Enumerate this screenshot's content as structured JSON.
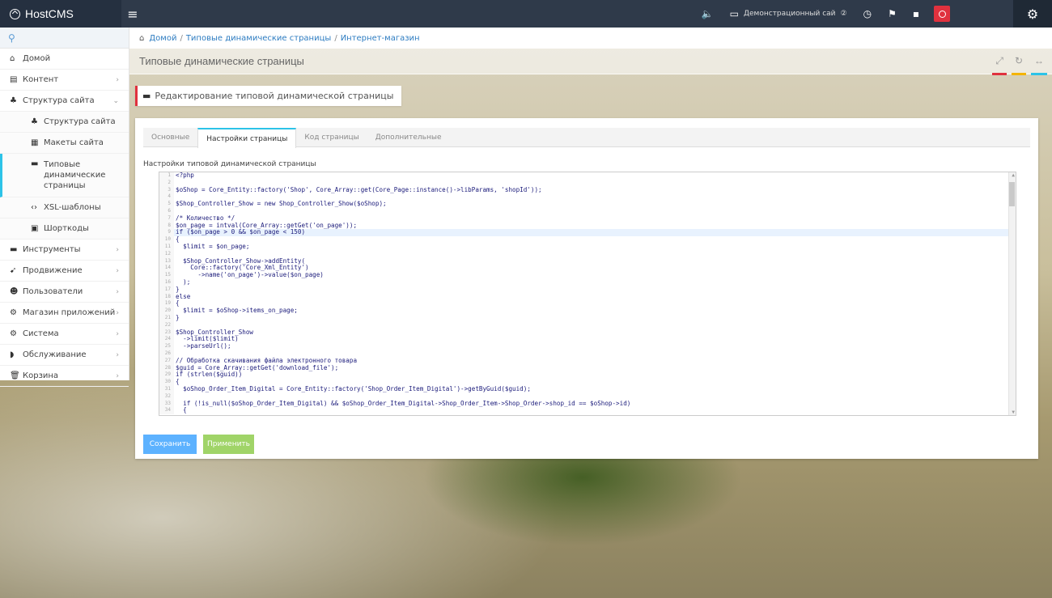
{
  "navbar": {
    "brand": "HostCMS",
    "menu_toggle": "≡",
    "site_label": "Демонстрационный сай",
    "site_badge": "②",
    "colors": {
      "bg": "#2f3a4a",
      "red": "#e0313e"
    }
  },
  "sidebar": {
    "search_icon": "search-icon",
    "items": [
      {
        "label": "Домой",
        "icon": "home-icon"
      },
      {
        "label": "Контент",
        "icon": "newspaper-icon"
      },
      {
        "label": "Структура сайта",
        "icon": "sitemap-icon"
      }
    ],
    "subitems": [
      {
        "label": "Структура сайта",
        "icon": "sitemap-icon"
      },
      {
        "label": "Макеты сайта",
        "icon": "grid-icon"
      },
      {
        "label": "Типовые\nдинамические\nстраницы",
        "icon": "files-icon"
      },
      {
        "label": "XSL-шаблоны",
        "icon": "code-icon"
      },
      {
        "label": "Шорткоды",
        "icon": "shortcode-icon"
      }
    ],
    "bottom_items": [
      {
        "label": "Инструменты",
        "icon": "tools-icon"
      },
      {
        "label": "Продвижение",
        "icon": "rocket-icon"
      },
      {
        "label": "Пользователи",
        "icon": "users-icon"
      },
      {
        "label": "Магазин приложений",
        "icon": "apps-icon"
      },
      {
        "label": "Система",
        "icon": "gear-icon"
      },
      {
        "label": "Обслуживание",
        "icon": "shield-icon"
      },
      {
        "label": "Корзина",
        "icon": "trash-icon"
      }
    ]
  },
  "breadcrumb": {
    "items": [
      "Домой",
      "Типовые динамические страницы",
      "Интернет-магазин"
    ],
    "sep": "/"
  },
  "page": {
    "title": "Типовые динамические страницы",
    "edit_title": "Редактирование типовой динамической страницы"
  },
  "tabs": [
    "Основные",
    "Настройки страницы",
    "Код страницы",
    "Дополнительные"
  ],
  "settings_label": "Настройки типовой динамической страницы",
  "code": [
    "<?php",
    "",
    "$oShop = Core_Entity::factory('Shop', Core_Array::get(Core_Page::instance()->libParams, 'shopId'));",
    "",
    "$Shop_Controller_Show = new Shop_Controller_Show($oShop);",
    "",
    "/* Количество */",
    "$on_page = intval(Core_Array::getGet('on_page'));",
    "if ($on_page > 0 && $on_page < 150)",
    "{",
    "  $limit = $on_page;",
    "",
    "  $Shop_Controller_Show->addEntity(",
    "    Core::factory('Core_Xml_Entity')",
    "      ->name('on_page')->value($on_page)",
    "  );",
    "}",
    "else",
    "{",
    "  $limit = $oShop->items_on_page;",
    "}",
    "",
    "$Shop_Controller_Show",
    "  ->limit($limit)",
    "  ->parseUrl();",
    "",
    "// Обработка скачивания файла электронного товара",
    "$guid = Core_Array::getGet('download_file');",
    "if (strlen($guid))",
    "{",
    "  $oShop_Order_Item_Digital = Core_Entity::factory('Shop_Order_Item_Digital')->getByGuid($guid);",
    "",
    "  if (!is_null($oShop_Order_Item_Digital) && $oShop_Order_Item_Digital->Shop_Order_Item->Shop_Order->shop_id == $oShop->id)",
    "  {"
  ],
  "buttons": {
    "save": "Сохранить",
    "apply": "Применить"
  }
}
